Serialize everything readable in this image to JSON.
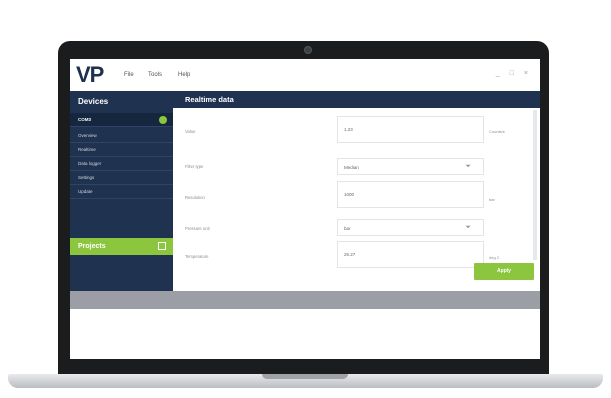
{
  "app": {
    "logo_main": "VP",
    "menu": [
      "File",
      "Tools",
      "Help"
    ],
    "window_controls": "_ □ ×"
  },
  "sidebar": {
    "title": "Devices",
    "items": [
      {
        "label": "COM3"
      },
      {
        "label": "Overview"
      },
      {
        "label": "Realtime"
      },
      {
        "label": "Data logger"
      },
      {
        "label": "Settings"
      },
      {
        "label": "Update"
      }
    ],
    "projects_label": "Projects"
  },
  "main": {
    "title": "Realtime data",
    "rows": [
      {
        "label": "Value",
        "value": "1.23",
        "unit": "Counts/s"
      },
      {
        "label": "Filter type",
        "value": "Median",
        "unit": ""
      },
      {
        "label": "Resolution",
        "value": "1000",
        "unit": "bar"
      },
      {
        "label": "Pressure unit",
        "value": "bar",
        "unit": ""
      },
      {
        "label": "Temperature",
        "value": "25.27",
        "unit": "deg C"
      }
    ],
    "apply_label": "Apply"
  },
  "colors": {
    "navy": "#1f3350",
    "accent_green": "#8cc63f"
  }
}
